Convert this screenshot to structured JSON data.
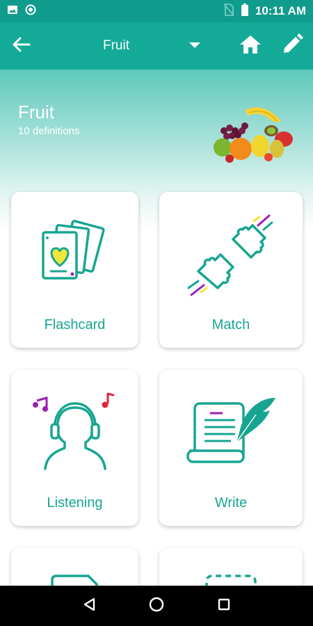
{
  "status_bar": {
    "time": "10:11 AM",
    "icons": [
      "image-icon",
      "circle-status-icon",
      "no-sim-icon",
      "battery-icon"
    ]
  },
  "app_bar": {
    "title": "Fruit",
    "icons": [
      "back-arrow-icon",
      "dropdown-caret-icon",
      "home-icon",
      "edit-pencil-icon"
    ]
  },
  "hero": {
    "title": "Fruit",
    "subtitle": "10 definitions"
  },
  "modes": [
    {
      "label": "Flashcard",
      "icon": "flashcard-icon"
    },
    {
      "label": "Match",
      "icon": "puzzle-match-icon"
    },
    {
      "label": "Listening",
      "icon": "headphones-listening-icon"
    },
    {
      "label": "Write",
      "icon": "scroll-quill-icon"
    }
  ],
  "nav_bar": {
    "icons": [
      "back-triangle-icon",
      "home-circle-icon",
      "recents-square-icon"
    ]
  },
  "colors": {
    "accent": "#14aa98",
    "status_bar": "#0f9c8c",
    "card_text": "#17a592",
    "heart": "#f3e63a",
    "music_note_purple": "#9b1fb3",
    "music_note_red": "#e0283a"
  }
}
